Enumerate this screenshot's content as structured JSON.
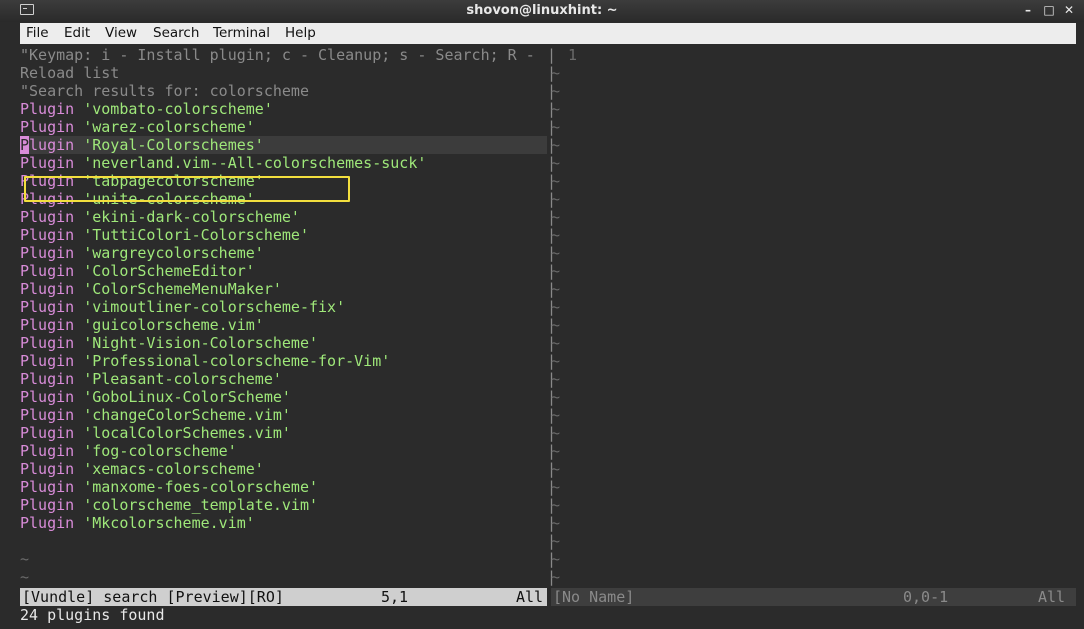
{
  "window": {
    "title": "shovon@linuxhint: ~"
  },
  "menu": [
    "File",
    "Edit",
    "View",
    "Search",
    "Terminal",
    "Help"
  ],
  "header_lines": {
    "keymap_line1": "\"Keymap: i - Install plugin; c - Cleanup; s - Search; R -",
    "keymap_line2": "Reload list",
    "search_line": "\"Search results for: colorscheme"
  },
  "plugin_keyword": "Plugin",
  "plugins": [
    "'vombato-colorscheme'",
    "'warez-colorscheme'",
    "'Royal-Colorschemes'",
    "'neverland.vim--All-colorschemes-suck'",
    "'tabpagecolorscheme'",
    "'unite-colorscheme'",
    "'ekini-dark-colorscheme'",
    "'TuttiColori-Colorscheme'",
    "'wargreycolorscheme'",
    "'ColorSchemeEditor'",
    "'ColorSchemeMenuMaker'",
    "'vimoutliner-colorscheme-fix'",
    "'guicolorscheme.vim'",
    "'Night-Vision-Colorscheme'",
    "'Professional-colorscheme-for-Vim'",
    "'Pleasant-colorscheme'",
    "'GoboLinux-ColorScheme'",
    "'changeColorScheme.vim'",
    "'localColorSchemes.vim'",
    "'fog-colorscheme'",
    "'xemacs-colorscheme'",
    "'manxome-foes-colorscheme'",
    "'colorscheme_template.vim'",
    "'Mkcolorscheme.vim'"
  ],
  "selected_plugin_index": 2,
  "right_pane": {
    "line_number": "1",
    "tilde": "~"
  },
  "status": {
    "left_name": "[Vundle] search [Preview][RO]",
    "left_pos": "5,1",
    "left_all": "All",
    "right_name": "[No Name]",
    "right_pos": "0,0-1",
    "right_all": "All"
  },
  "message": "24 plugins found",
  "colors": {
    "background": "#2b2b2b",
    "keyword": "#d98cd9",
    "string": "#9fe87a",
    "comment": "#8a8a8a",
    "highlight_box": "#f3df3e"
  }
}
